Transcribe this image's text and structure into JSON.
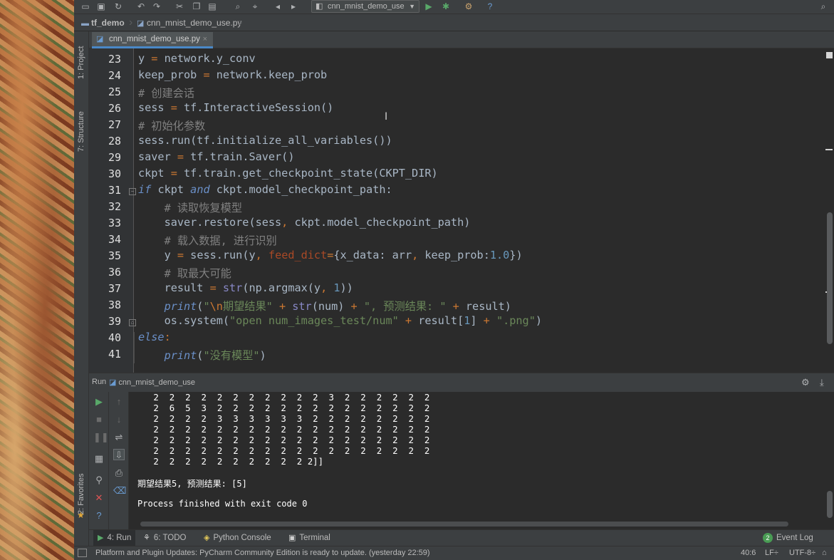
{
  "toolbar": {
    "run_config": "cnn_mnist_demo_use",
    "icons": [
      "folder-open-icon",
      "save-icon",
      "sync-icon",
      "undo-icon",
      "redo-icon",
      "cut-icon",
      "copy-icon",
      "paste-icon",
      "find-icon",
      "replace-icon",
      "back-icon",
      "forward-icon",
      "run-config-icon",
      "run-icon",
      "debug-icon",
      "settings-icon",
      "help-icon",
      "search-everywhere-icon"
    ]
  },
  "breadcrumb": {
    "project": "tf_demo",
    "file": "cnn_mnist_demo_use.py"
  },
  "side_tabs": {
    "project": "1: Project",
    "structure": "7: Structure",
    "favorites": "2: Favorites"
  },
  "editor_tab": {
    "label": "cnn_mnist_demo_use.py",
    "close": "×"
  },
  "editor": {
    "line_numbers": [
      "23",
      "24",
      "25",
      "26",
      "27",
      "28",
      "29",
      "30",
      "31",
      "32",
      "33",
      "34",
      "35",
      "36",
      "37",
      "38",
      "39",
      "40",
      "41"
    ],
    "cursor_glyph": "I"
  },
  "run": {
    "label": "Run",
    "config": "cnn_mnist_demo_use",
    "console_rows": [
      "   2  2  2  2  2  2  2  2  2  2  2  3  2  2  2  2  2  2",
      "   2  6  5  3  2  2  2  2  2  2  2  2  2  2  2  2  2  2",
      "   2  2  2  2  3  3  3  3  3  3  2  2  2  2  2  2  2  2",
      "   2  2  2  2  2  2  2  2  2  2  2  2  2  2  2  2  2  2",
      "   2  2  2  2  2  2  2  2  2  2  2  2  2  2  2  2  2  2",
      "   2  2  2  2  2  2  2  2  2  2  2  2  2  2  2  2  2  2",
      "   2  2  2  2  2  2  2  2  2  2 2]]"
    ],
    "result_line": "期望结果5, 预测结果: [5]",
    "exit_line": "Process finished with exit code 0"
  },
  "bottom_tabs": {
    "run": "4: Run",
    "todo": "6: TODO",
    "python_console": "Python Console",
    "terminal": "Terminal",
    "event_log": "Event Log",
    "event_count": "2"
  },
  "status": {
    "message": "Platform and Plugin Updates: PyCharm Community Edition is ready to update. (yesterday 22:59)",
    "position": "40:6",
    "line_sep": "LF÷",
    "encoding": "UTF-8÷"
  }
}
